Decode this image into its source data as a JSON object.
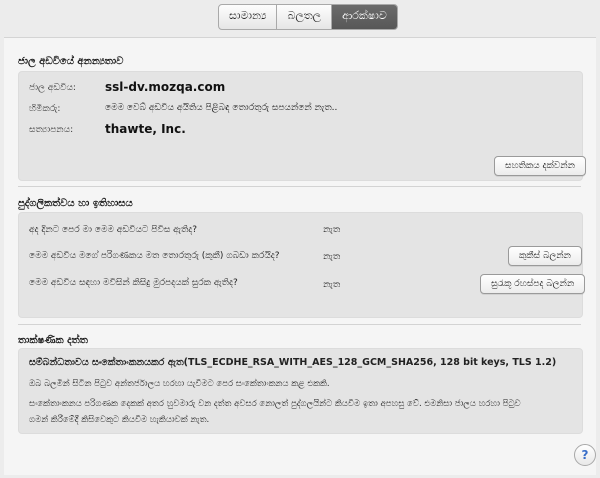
{
  "tabs": [
    {
      "label": "සාමාන්‍ය",
      "selected": false
    },
    {
      "label": "බලතල",
      "selected": false
    },
    {
      "label": "ආරක්ෂාව",
      "selected": true
    }
  ],
  "identity": {
    "title": "ජාල අඩවියේ අනන්‍යතාව",
    "website_label": "ජාල අඩවිය:",
    "website_value": "ssl-dv.mozqa.com",
    "owner_label": "හිමිකරු:",
    "owner_value": "මෙම වෙබ් අඩවිය අයිතිය පිළිබඳ තොරතුරු සපයන්නේ නැත..",
    "verifier_label": "සත්‍යාපනය:",
    "verifier_value": "thawte, Inc.",
    "view_cert_button": "සහතිකය දක්වන්න"
  },
  "privacy": {
    "title": "පුද්ගලිකත්වය හා ඉතිහාසය",
    "q1": "අද දිනට පෙර මා මෙම අඩවියට පිවිස ඇතිද?",
    "a1": "නැත",
    "q2": "මෙම අඩවිය මගේ පරිගණකය මත තොරතුරු (කුකී) ගබඩා කරයිද?",
    "a2": "නැත",
    "cookies_button": "කුකීස් බලන්න",
    "q3": "මෙම අඩවිය සඳහා මවිසින් කිසිදු මුරපදයක් සුරක ඇතිද?",
    "a3": "නැත",
    "passwords_button": "සුරැකූ රහස්පද බලන්න"
  },
  "technical": {
    "title": "තාක්ෂණික දත්ත",
    "line1": "සම්බන්ධතාවය සංකේතාංකනයකර ඇත(TLS_ECDHE_RSA_WITH_AES_128_GCM_SHA256, 128 bit keys, TLS 1.2)",
    "line2": "ඔබ බලමින් සිටින පිටුව අන්තර්ජාලය හරහා යැවීමට පෙර සංකේතාංකනය කළ එකකි.",
    "line3a": "සංකේතාංකනය පරිගණක දෙකක් අතර හුවමාරු වන දත්ත අවසර නොලත් පුද්ගලයින්ට කියවීම ඉතා අපහසු වේ. එමනිසා ජාලය හරහා පිටුව",
    "line3b": "ගමන් කිරීමේදී කිසිවෙකුට කියවීම හැකියාවක් නැත."
  },
  "help_label": "?"
}
